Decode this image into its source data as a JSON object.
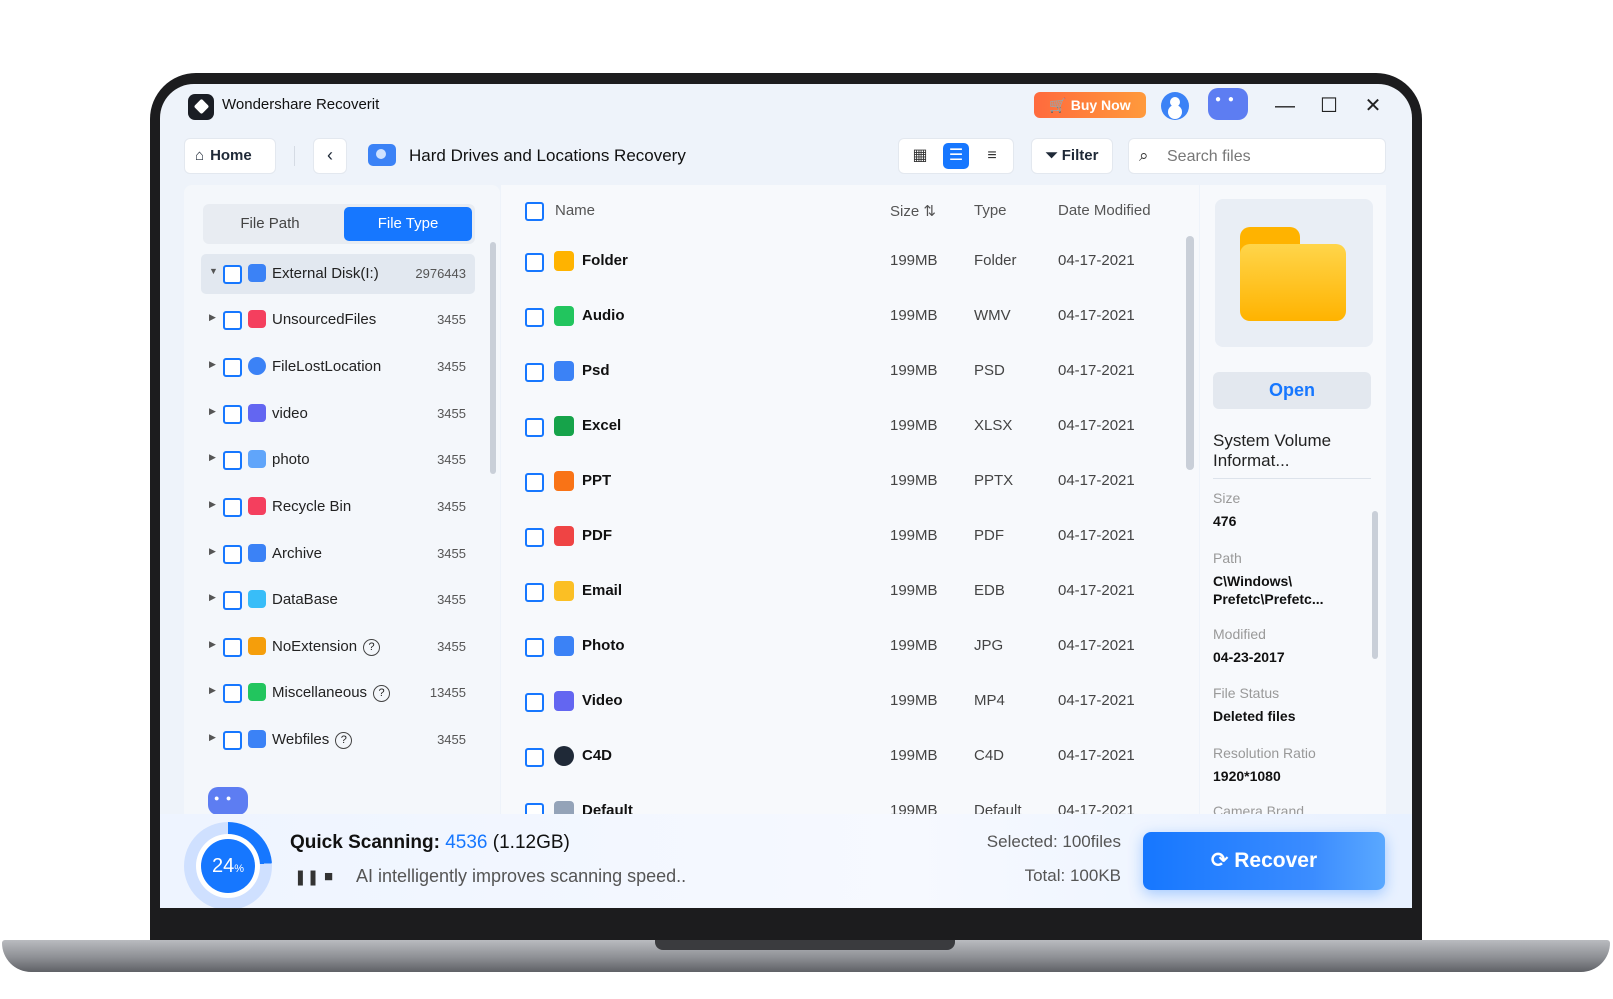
{
  "app": {
    "title": "Wondershare Recoverit",
    "buy_now": "Buy Now"
  },
  "toolbar": {
    "home": "Home",
    "page_title": "Hard Drives and Locations Recovery",
    "filter": "Filter",
    "search_placeholder": "Search files"
  },
  "tabs": {
    "file_path": "File Path",
    "file_type": "File Type"
  },
  "tree": [
    {
      "label": "External Disk(I:)",
      "count": "2976443",
      "color": "#3b82f6"
    },
    {
      "label": "UnsourcedFiles",
      "count": "3455",
      "color": "#f43f5e"
    },
    {
      "label": "FileLostLocation",
      "count": "3455",
      "color": "#3b82f6"
    },
    {
      "label": "video",
      "count": "3455",
      "color": "#6366f1"
    },
    {
      "label": "photo",
      "count": "3455",
      "color": "#60a5fa"
    },
    {
      "label": "Recycle Bin",
      "count": "3455",
      "color": "#f43f5e"
    },
    {
      "label": "Archive",
      "count": "3455",
      "color": "#3b82f6"
    },
    {
      "label": "DataBase",
      "count": "3455",
      "color": "#38bdf8"
    },
    {
      "label": "NoExtension",
      "count": "3455",
      "color": "#f59e0b"
    },
    {
      "label": "Miscellaneous",
      "count": "13455",
      "color": "#22c55e"
    },
    {
      "label": "Webfiles",
      "count": "3455",
      "color": "#3b82f6"
    }
  ],
  "columns": {
    "name": "Name",
    "size": "Size",
    "type": "Type",
    "date": "Date Modified"
  },
  "files": [
    {
      "name": "Folder",
      "size": "199MB",
      "type": "Folder",
      "date": "04-17-2021",
      "color": "#ffb300"
    },
    {
      "name": "Audio",
      "size": "199MB",
      "type": "WMV",
      "date": "04-17-2021",
      "color": "#22c55e"
    },
    {
      "name": "Psd",
      "size": "199MB",
      "type": "PSD",
      "date": "04-17-2021",
      "color": "#3b82f6"
    },
    {
      "name": "Excel",
      "size": "199MB",
      "type": "XLSX",
      "date": "04-17-2021",
      "color": "#16a34a"
    },
    {
      "name": "PPT",
      "size": "199MB",
      "type": "PPTX",
      "date": "04-17-2021",
      "color": "#f97316"
    },
    {
      "name": "PDF",
      "size": "199MB",
      "type": "PDF",
      "date": "04-17-2021",
      "color": "#ef4444"
    },
    {
      "name": "Email",
      "size": "199MB",
      "type": "EDB",
      "date": "04-17-2021",
      "color": "#fbbf24"
    },
    {
      "name": "Photo",
      "size": "199MB",
      "type": "JPG",
      "date": "04-17-2021",
      "color": "#3b82f6"
    },
    {
      "name": "Video",
      "size": "199MB",
      "type": "MP4",
      "date": "04-17-2021",
      "color": "#6366f1"
    },
    {
      "name": "C4D",
      "size": "199MB",
      "type": "C4D",
      "date": "04-17-2021",
      "color": "#1f2937"
    },
    {
      "name": "Default",
      "size": "199MB",
      "type": "Default",
      "date": "04-17-2021",
      "color": "#94a3b8"
    }
  ],
  "details": {
    "open": "Open",
    "name": "System Volume Informat...",
    "size_label": "Size",
    "size": "476",
    "path_label": "Path",
    "path": "C\\Windows\\ Prefetc\\Prefetc...",
    "modified_label": "Modified",
    "modified": "04-23-2017",
    "status_label": "File Status",
    "status": "Deleted files",
    "resolution_label": "Resolution Ratio",
    "resolution": "1920*1080",
    "camera_label": "Camera Brand"
  },
  "scan": {
    "percent": "24",
    "percent_unit": "%",
    "title": "Quick Scanning:",
    "count": "4536",
    "size": "(1.12GB)",
    "hint": "AI intelligently improves scanning speed..",
    "selected": "Selected: 100files",
    "total": "Total: 100KB",
    "recover": "Recover"
  }
}
